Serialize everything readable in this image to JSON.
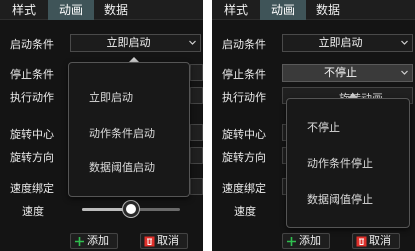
{
  "tabs": [
    "样式",
    "动画",
    "数据"
  ],
  "active_tab": "动画",
  "labels": {
    "start_condition": "启动条件",
    "stop_condition": "停止条件",
    "action": "执行动作",
    "rotation_center": "旋转中心",
    "rotation_direction": "旋转方向",
    "speed_binding": "速度绑定",
    "speed": "速度"
  },
  "left_panel": {
    "start_condition_value": "立即启动",
    "start_menu_options": [
      "立即启动",
      "动作条件启动",
      "数据阈值启动"
    ],
    "speed_slider_fraction": 0.5
  },
  "right_panel": {
    "start_condition_value": "立即启动",
    "stop_condition_value": "不停止",
    "action_value_partial": "旋转动画",
    "stop_menu_options": [
      "不停止",
      "动作条件停止",
      "数据阈值停止"
    ]
  },
  "buttons": {
    "add": "添加",
    "cancel": "取消"
  },
  "colors": {
    "panel_bg": "#141414",
    "active_tab_bg": "#3f5458",
    "add_icon": "#2fbf4f",
    "cancel_icon": "#e0302a"
  }
}
